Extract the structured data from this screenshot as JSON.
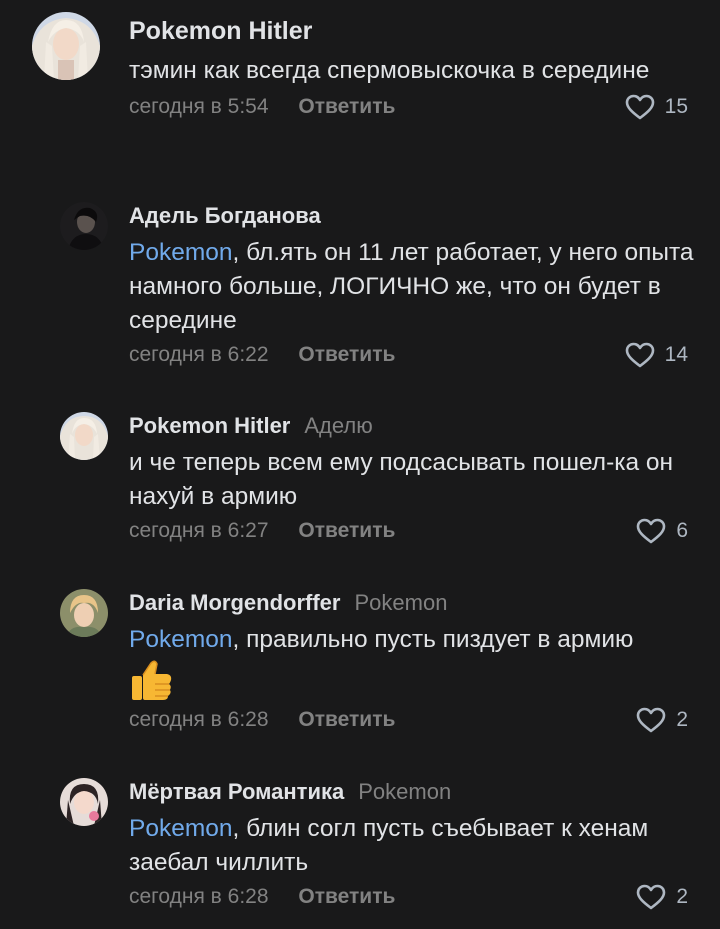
{
  "colors": {
    "background": "#19191a",
    "text": "#e1e3e6",
    "secondary": "#828282",
    "link": "#71aaeb"
  },
  "comments": [
    {
      "author": "Pokemon Hitler",
      "reply_to": "",
      "mention": "",
      "text": "тэмин как всегда спермовыскочка в середине",
      "time": "сегодня в 5:54",
      "reply_label": "Ответить",
      "likes": "15",
      "like_icon": "heart-outline-icon"
    },
    {
      "author": "Адель Богданова",
      "reply_to": "",
      "mention": "Pokemon",
      "text": ", бл.ять он 11 лет работает, у него опыта намного больше, ЛОГИЧНО же, что он будет в середине",
      "time": "сегодня в 6:22",
      "reply_label": "Ответить",
      "likes": "14",
      "like_icon": "heart-outline-icon"
    },
    {
      "author": "Pokemon Hitler",
      "reply_to": "Аделю",
      "mention": "",
      "text": "и че теперь всем ему подсасывать пошел-ка он нахуй в армию",
      "time": "сегодня в 6:27",
      "reply_label": "Ответить",
      "likes": "6",
      "like_icon": "heart-outline-icon"
    },
    {
      "author": "Daria Morgendorffer",
      "reply_to": "Pokemon",
      "mention": "Pokemon",
      "text": ", правильно пусть пиздует в армию",
      "emoji": "thumbs-up-emoji",
      "time": "сегодня в 6:28",
      "reply_label": "Ответить",
      "likes": "2",
      "like_icon": "heart-outline-icon"
    },
    {
      "author": "Мёртвая Романтика",
      "reply_to": "Pokemon",
      "mention": "Pokemon",
      "text": ", блин согл пусть съебывает к хенам заебал чиллить",
      "time": "сегодня в 6:28",
      "reply_label": "Ответить",
      "likes": "2",
      "like_icon": "heart-outline-icon"
    }
  ]
}
